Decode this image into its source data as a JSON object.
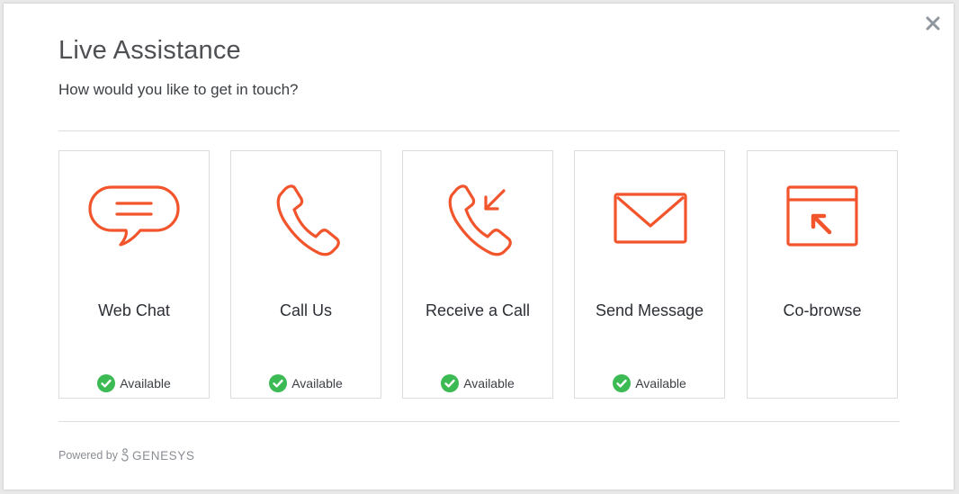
{
  "dialog": {
    "title": "Live Assistance",
    "subtitle": "How would you like to get in touch?",
    "close_icon": "close-icon"
  },
  "colors": {
    "accent": "#f2552c",
    "available": "#3cba54",
    "divider": "#dedede"
  },
  "options": [
    {
      "label": "Web Chat",
      "icon": "chat-bubble-icon",
      "status": "Available"
    },
    {
      "label": "Call Us",
      "icon": "phone-icon",
      "status": "Available"
    },
    {
      "label": "Receive a Call",
      "icon": "phone-incoming-icon",
      "status": "Available"
    },
    {
      "label": "Send Message",
      "icon": "envelope-icon",
      "status": "Available"
    },
    {
      "label": "Co-browse",
      "icon": "co-browse-icon",
      "status": ""
    }
  ],
  "footer": {
    "powered_by": "Powered by",
    "brand": "GENESYS",
    "logo_icon": "genesys-logo-icon"
  }
}
